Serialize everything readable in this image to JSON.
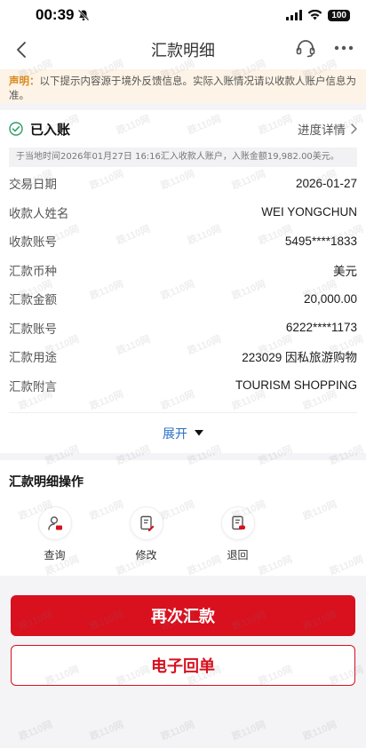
{
  "status_bar": {
    "time": "00:39",
    "battery": "100"
  },
  "nav": {
    "title": "汇款明细",
    "back_icon": "chevron-left-icon",
    "headset_icon": "headset-icon",
    "more_icon": "more-dots-icon"
  },
  "notice": {
    "label": "声明：",
    "text": "以下提示内容源于境外反馈信息。实际入账情况请以收款人账户信息为准。"
  },
  "status": {
    "label": "已入账",
    "progress_link": "进度详情",
    "note": "于当地时间2026年01月27日 16:16汇入收款人账户，入账金额19,982.00美元。"
  },
  "details": [
    {
      "label": "交易日期",
      "value": "2026-01-27"
    },
    {
      "label": "收款人姓名",
      "value": "WEI YONGCHUN"
    },
    {
      "label": "收款账号",
      "value": "5495****1833"
    },
    {
      "label": "汇款币种",
      "value": "美元"
    },
    {
      "label": "汇款金额",
      "value": "20,000.00"
    },
    {
      "label": "汇款账号",
      "value": "6222****1173"
    },
    {
      "label": "汇款用途",
      "value": "223029 因私旅游购物"
    },
    {
      "label": "汇款附言",
      "value": "TOURISM SHOPPING"
    }
  ],
  "expand_label": "展开",
  "operations": {
    "title": "汇款明细操作",
    "items": [
      {
        "label": "查询",
        "icon": "person-search-icon"
      },
      {
        "label": "修改",
        "icon": "doc-edit-icon"
      },
      {
        "label": "退回",
        "icon": "doc-return-icon"
      }
    ]
  },
  "buttons": {
    "primary": "再次汇款",
    "secondary": "电子回单"
  },
  "watermark": "跌110网",
  "colors": {
    "accent_red": "#d9101e",
    "link_blue": "#2a6fc9",
    "notice_orange": "#d98a1c",
    "success_green": "#2e9c6a"
  }
}
